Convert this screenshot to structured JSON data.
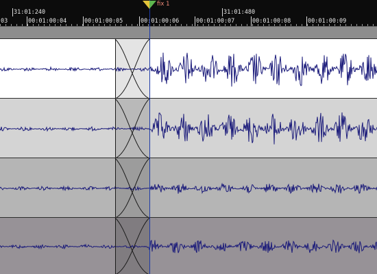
{
  "ruler": {
    "timecodes_major": [
      "31:01:240",
      "31:01:480"
    ],
    "timecodes_minor": [
      "03",
      "00:01:00:04",
      "00:01:00:05",
      "00:01:00:06",
      "00:01:00:07",
      "00:01:00:08",
      "00:01:00:09"
    ]
  },
  "marker": {
    "label": "fix 1",
    "flag_colors": [
      "#e2c33a",
      "#5fb64e"
    ]
  },
  "tracks": [
    {
      "bg": "#ffffff",
      "fade_bg": "#e4e4e4"
    },
    {
      "bg": "#d4d4d4",
      "fade_bg": "#b9b9b9"
    },
    {
      "bg": "#b5b5b5",
      "fade_bg": "#9c9c9c"
    },
    {
      "bg": "#979297",
      "fade_bg": "#807c80"
    }
  ],
  "colors": {
    "waveform": "#1a1a7a",
    "playhead": "#1d3aa8",
    "ruler_bg": "#0c0c0c"
  }
}
